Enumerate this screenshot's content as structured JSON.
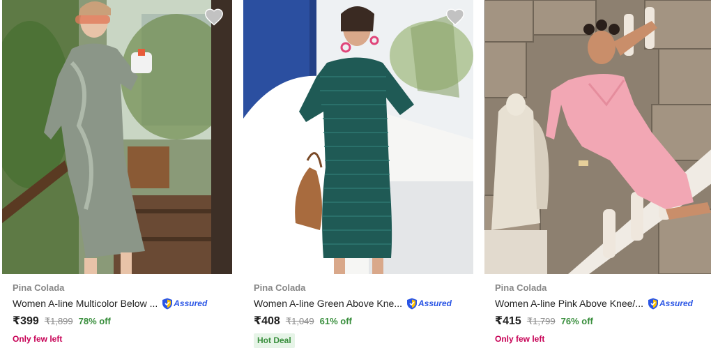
{
  "products": [
    {
      "brand": "Pina Colada",
      "title": "Women A-line Multicolor Below ...",
      "assured_label": "Assured",
      "price": "₹399",
      "mrp": "₹1,899",
      "discount": "78% off",
      "tag": "Only few left",
      "image_alt": "Woman in grey floral knee-length dress holding a mug on a staircase among plants",
      "wishlist_icon": "heart-icon"
    },
    {
      "brand": "Pina Colada",
      "title": "Women A-line Green Above Kne...",
      "assured_label": "Assured",
      "price": "₹408",
      "mrp": "₹1,049",
      "discount": "61% off",
      "tag": "Hot Deal",
      "image_alt": "Woman in green striped bodycon dress with tan handbag against white and blue walls",
      "wishlist_icon": "heart-icon"
    },
    {
      "brand": "Pina Colada",
      "title": "Women A-line Pink Above Knee/...",
      "assured_label": "Assured",
      "price": "₹415",
      "mrp": "₹1,799",
      "discount": "76% off",
      "tag": "Only few left",
      "image_alt": "Woman in pink wrap dress posing on a staircase beside an angel statue",
      "wishlist_icon": "heart-icon"
    }
  ],
  "colors": {
    "price_off": "#388e3c",
    "urgency": "#c70055",
    "assured": "#2a55e5",
    "muted": "#878787"
  }
}
